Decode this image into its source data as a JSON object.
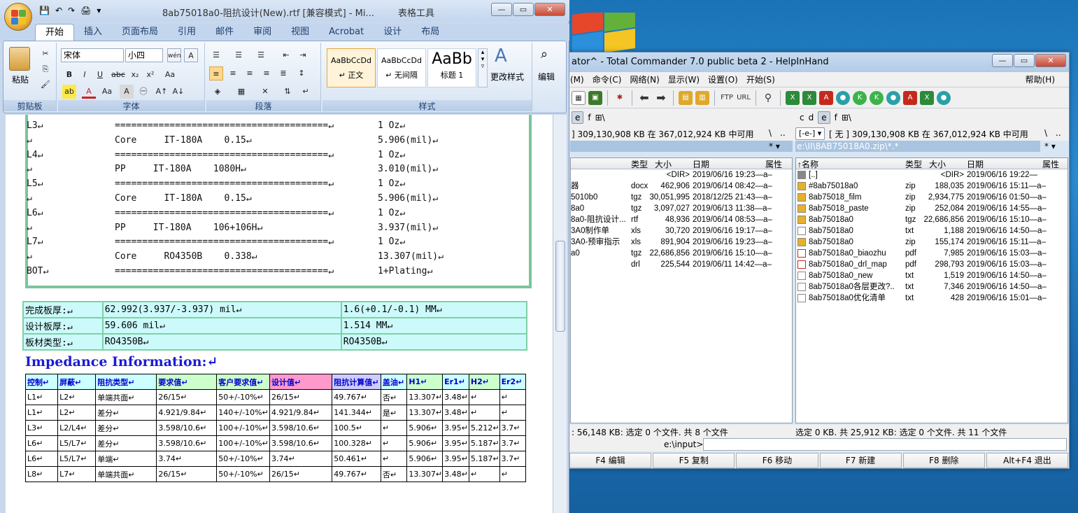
{
  "word": {
    "qat_labels": [
      "💾",
      "↶",
      "↷",
      "🖨",
      "▾"
    ],
    "title": "8ab75018a0-阻抗设计(New).rtf [兼容模式] - Mi...",
    "context_tab": "表格工具",
    "tabs": [
      "开始",
      "插入",
      "页面布局",
      "引用",
      "邮件",
      "审阅",
      "视图",
      "Acrobat",
      "设计",
      "布局"
    ],
    "font_name": "宋体",
    "font_size": "小四",
    "paste": "粘贴",
    "groups": [
      "剪贴板",
      "字体",
      "段落",
      "样式"
    ],
    "styles": [
      {
        "sample": "AaBbCcDd",
        "name": "↵ 正文"
      },
      {
        "sample": "AaBbCcDd",
        "name": "↵ 无间隔"
      },
      {
        "sample": "AaBb",
        "name": "标题 1"
      }
    ],
    "change_styles": "更改样式",
    "edit": "编辑"
  },
  "stackup": [
    {
      "left": "L3↵",
      "mid": "=======================================↵",
      "right": "1 Oz↵"
    },
    {
      "left": "↵",
      "mid": "Core     IT-180A    0.15↵",
      "right": "5.906(mil)↵"
    },
    {
      "left": "L4↵",
      "mid": "=======================================↵",
      "right": "1 Oz↵"
    },
    {
      "left": "↵",
      "mid": "PP     IT-180A    1080H↵",
      "right": "3.010(mil)↵"
    },
    {
      "left": "L5↵",
      "mid": "=======================================↵",
      "right": "1 Oz↵"
    },
    {
      "left": "↵",
      "mid": "Core     IT-180A    0.15↵",
      "right": "5.906(mil)↵"
    },
    {
      "left": "L6↵",
      "mid": "=======================================↵",
      "right": "1 Oz↵"
    },
    {
      "left": "↵",
      "mid": "PP     IT-180A    106+106H↵",
      "right": "3.937(mil)↵"
    },
    {
      "left": "L7↵",
      "mid": "=======================================↵",
      "right": "1 Oz↵"
    },
    {
      "left": "↵",
      "mid": "Core     RO4350B    0.338↵",
      "right": "13.307(mil)↵"
    },
    {
      "left": "BOT↵",
      "mid": "=======================================↵",
      "right": "1+Plating↵"
    }
  ],
  "board": [
    [
      "完成板厚:↵",
      "62.992(3.937/-3.937) mil↵",
      "1.6(+0.1/-0.1) MM↵"
    ],
    [
      "设计板厚:↵",
      "59.606 mil↵",
      "1.514 MM↵"
    ],
    [
      "板材类型:↵",
      "RO4350B↵",
      "RO4350B↵"
    ]
  ],
  "impedance_title": "Impedance Information:↵",
  "imp_headers": [
    "控制↵",
    "屏蔽↵",
    "阻抗类型↵",
    "要求值↵",
    "客户要求值↵",
    "设计值↵",
    "阻抗计算值↵",
    "盖油↵",
    "H1↵",
    "Er1↵",
    "H2↵",
    "Er2↵"
  ],
  "imp_rows": [
    [
      "L1↵",
      "L2↵",
      "单端共面↵",
      "26/15↵",
      "50+/-10%↵",
      "26/15↵",
      "49.767↵",
      "否↵",
      "13.307↵",
      "3.48↵",
      "↵",
      "↵"
    ],
    [
      "L1↵",
      "L2↵",
      "差分↵",
      "4.921/9.84↵",
      "140+/-10%↵",
      "4.921/9.84↵",
      "141.344↵",
      "是↵",
      "13.307↵",
      "3.48↵",
      "↵",
      "↵"
    ],
    [
      "L3↵",
      "L2/L4↵",
      "差分↵",
      "3.598/10.6↵",
      "100+/-10%↵",
      "3.598/10.6↵",
      "100.5↵",
      "↵",
      "5.906↵",
      "3.95↵",
      "5.212↵",
      "3.7↵"
    ],
    [
      "L6↵",
      "L5/L7↵",
      "差分↵",
      "3.598/10.6↵",
      "100+/-10%↵",
      "3.598/10.6↵",
      "100.328↵",
      "↵",
      "5.906↵",
      "3.95↵",
      "5.187↵",
      "3.7↵"
    ],
    [
      "L6↵",
      "L5/L7↵",
      "单端↵",
      "3.74↵",
      "50+/-10%↵",
      "3.74↵",
      "50.461↵",
      "↵",
      "5.906↵",
      "3.95↵",
      "5.187↵",
      "3.7↵"
    ],
    [
      "L8↵",
      "L7↵",
      "单端共面↵",
      "26/15↵",
      "50+/-10%↵",
      "26/15↵",
      "49.767↵",
      "否↵",
      "13.307↵",
      "3.48↵",
      "↵",
      "↵"
    ]
  ],
  "tc": {
    "title": "ator^ - Total Commander 7.0 public beta 2 - HelpInHand",
    "menu": [
      "(M)",
      "命令(C)",
      "网络(N)",
      "显示(W)",
      "设置(O)",
      "开始(S)"
    ],
    "help": "帮助(H)",
    "left_drives": [
      "e",
      "f"
    ],
    "right_drives": [
      "c",
      "d",
      "e",
      "f"
    ],
    "left_info": "]  309,130,908 KB 在 367,012,924 KB 中可用",
    "right_drive_sel": "[-e-] ▾",
    "right_info": "[ 无 ]  309,130,908 KB 在 367,012,924 KB 中可用",
    "backslash": "\\",
    "dotdot": "..",
    "right_path": "e:\\II\\8AB75018A0.zip\\*.*",
    "filter": "* ▾",
    "col_headers": {
      "name": "↑名称",
      "type": "类型",
      "size": "大小",
      "date": "日期",
      "attr": "属性"
    },
    "left_rows": [
      {
        "name": "",
        "type": "",
        "size": "<DIR>",
        "date": "2019/06/16 19:23—a–"
      },
      {
        "name": "器",
        "type": "docx",
        "size": "462,906",
        "date": "2019/06/14 08:42—a–"
      },
      {
        "name": "5010b0",
        "type": "tgz",
        "size": "30,051,995",
        "date": "2018/12/25 21:43—a–"
      },
      {
        "name": "8a0",
        "type": "tgz",
        "size": "3,097,027",
        "date": "2019/06/13 11:38—a–"
      },
      {
        "name": "8a0-阻抗设计...",
        "type": "rtf",
        "size": "48,936",
        "date": "2019/06/14 08:53—a–"
      },
      {
        "name": "3A0制作单",
        "type": "xls",
        "size": "30,720",
        "date": "2019/06/16 19:17—a–"
      },
      {
        "name": "3A0-预审指示",
        "type": "xls",
        "size": "891,904",
        "date": "2019/06/16 19:23—a–"
      },
      {
        "name": "a0",
        "type": "tgz",
        "size": "22,686,856",
        "date": "2019/06/16 15:10—a–"
      },
      {
        "name": "",
        "type": "drl",
        "size": "225,544",
        "date": "2019/06/11 14:42—a–"
      }
    ],
    "right_rows": [
      {
        "name": "[..]",
        "type": "",
        "size": "<DIR>",
        "date": "2019/06/16 19:22—",
        "icon": "up"
      },
      {
        "name": "#8ab75018a0",
        "type": "zip",
        "size": "188,035",
        "date": "2019/06/16 15:11—a–",
        "icon": "zip"
      },
      {
        "name": "8ab75018_film",
        "type": "zip",
        "size": "2,934,775",
        "date": "2019/06/16 01:50—a–",
        "icon": "zip"
      },
      {
        "name": "8ab75018_paste",
        "type": "zip",
        "size": "252,084",
        "date": "2019/06/16 14:55—a–",
        "icon": "zip"
      },
      {
        "name": "8ab75018a0",
        "type": "tgz",
        "size": "22,686,856",
        "date": "2019/06/16 15:10—a–",
        "icon": "zip"
      },
      {
        "name": "8ab75018a0",
        "type": "txt",
        "size": "1,188",
        "date": "2019/06/16 14:50—a–",
        "icon": "txt"
      },
      {
        "name": "8ab75018a0",
        "type": "zip",
        "size": "155,174",
        "date": "2019/06/16 15:11—a–",
        "icon": "zip"
      },
      {
        "name": "8ab75018a0_biaozhu",
        "type": "pdf",
        "size": "7,985",
        "date": "2019/06/16 15:03—a–",
        "icon": "pdf"
      },
      {
        "name": "8ab75018a0_drl_map",
        "type": "pdf",
        "size": "298,793",
        "date": "2019/06/16 15:03—a–",
        "icon": "pdf"
      },
      {
        "name": "8ab75018a0_new",
        "type": "txt",
        "size": "1,519",
        "date": "2019/06/16 14:50—a–",
        "icon": "txt"
      },
      {
        "name": "8ab75018a0各层更改?..",
        "type": "txt",
        "size": "7,346",
        "date": "2019/06/16 14:50—a–",
        "icon": "txt"
      },
      {
        "name": "8ab75018a0优化清单",
        "type": "txt",
        "size": "428",
        "date": "2019/06/16 15:01—a–",
        "icon": "txt"
      }
    ],
    "left_status": ": 56,148 KB: 选定 0 个文件. 共 8 个文件",
    "right_status": "选定 0 KB. 共 25,912 KB: 选定 0 个文件. 共 11 个文件",
    "cmd_path": "e:\\input>",
    "fkeys": [
      "F4 编辑",
      "F5 复制",
      "F6 移动",
      "F7 新建",
      "F8 删除",
      "Alt+F4 退出"
    ]
  }
}
